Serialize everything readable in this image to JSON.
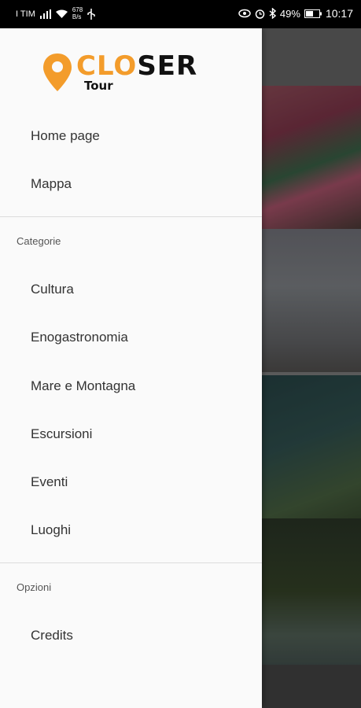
{
  "status_bar": {
    "carrier": "I TIM",
    "net_speed_value": "678",
    "net_speed_unit": "B/s",
    "battery_percent": "49%",
    "time": "10:17",
    "icons": [
      "signal-icon",
      "wifi-icon",
      "usb-icon",
      "eye-icon",
      "alarm-icon",
      "bluetooth-icon",
      "battery-icon"
    ]
  },
  "drawer": {
    "logo": {
      "word_accent": "CLO",
      "word_main": "SER",
      "sub": "Tour",
      "accent_color": "#f39c2b"
    },
    "top_items": [
      {
        "label": "Home page"
      },
      {
        "label": "Mappa"
      }
    ],
    "categories": {
      "header": "Categorie",
      "items": [
        {
          "label": "Cultura"
        },
        {
          "label": "Enogastronomia"
        },
        {
          "label": "Mare e Montagna"
        },
        {
          "label": "Escursioni"
        },
        {
          "label": "Eventi"
        },
        {
          "label": "Luoghi"
        }
      ]
    },
    "options": {
      "header": "Opzioni",
      "items": [
        {
          "label": "Credits"
        }
      ]
    }
  }
}
